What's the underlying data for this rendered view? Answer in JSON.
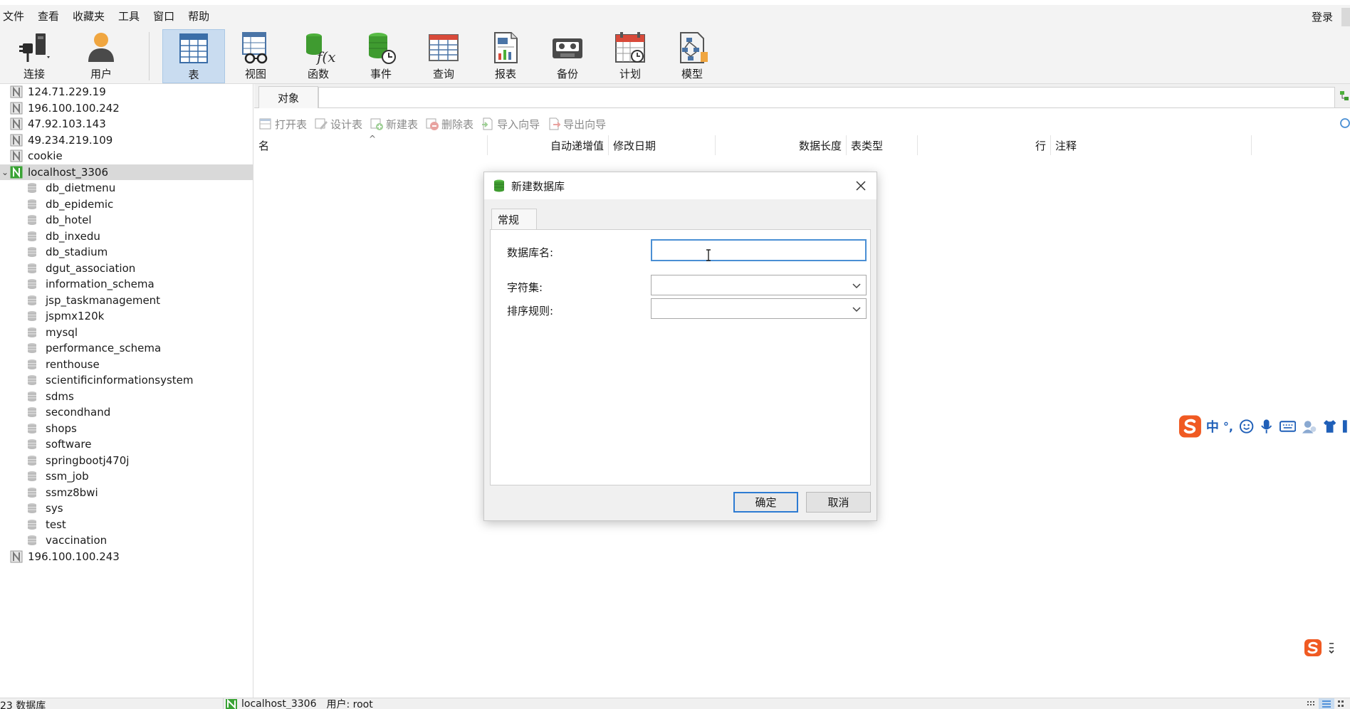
{
  "menu": {
    "items": [
      "文件",
      "查看",
      "收藏夹",
      "工具",
      "窗口",
      "帮助"
    ],
    "login": "登录"
  },
  "toolbar": {
    "buttons": [
      {
        "label": "连接",
        "icon": "plug-icon"
      },
      {
        "label": "用户",
        "icon": "user-icon"
      },
      {
        "label": "表",
        "icon": "table-icon",
        "active": true
      },
      {
        "label": "视图",
        "icon": "view-glasses-icon"
      },
      {
        "label": "函数",
        "icon": "function-icon"
      },
      {
        "label": "事件",
        "icon": "event-clock-icon"
      },
      {
        "label": "查询",
        "icon": "query-icon"
      },
      {
        "label": "报表",
        "icon": "report-icon"
      },
      {
        "label": "备份",
        "icon": "backup-tape-icon"
      },
      {
        "label": "计划",
        "icon": "calendar-icon"
      },
      {
        "label": "模型",
        "icon": "model-icon"
      }
    ]
  },
  "tree": {
    "connections_top": [
      "124.71.229.19",
      "196.100.100.242",
      "47.92.103.143",
      "49.234.219.109",
      "cookie"
    ],
    "selected_connection": "localhost_3306",
    "databases": [
      "db_dietmenu",
      "db_epidemic",
      "db_hotel",
      "db_inxedu",
      "db_stadium",
      "dgut_association",
      "information_schema",
      "jsp_taskmanagement",
      "jspmx120k",
      "mysql",
      "performance_schema",
      "renthouse",
      "scientificinformationsystem",
      "sdms",
      "secondhand",
      "shops",
      "software",
      "springbootj470j",
      "ssm_job",
      "ssmz8bwi",
      "sys",
      "test",
      "vaccination"
    ],
    "connections_bottom": [
      "196.100.100.243"
    ]
  },
  "objects": {
    "tab_label": "对象",
    "actions": [
      "打开表",
      "设计表",
      "新建表",
      "删除表",
      "导入向导",
      "导出向导"
    ],
    "columns": [
      "名",
      "自动递增值",
      "修改日期",
      "数据长度",
      "表类型",
      "行",
      "注释"
    ]
  },
  "dialog": {
    "title": "新建数据库",
    "tab": "常规",
    "fields": {
      "name_label": "数据库名:",
      "name_value": "",
      "charset_label": "字符集:",
      "charset_value": "",
      "collation_label": "排序规则:",
      "collation_value": ""
    },
    "ok": "确定",
    "cancel": "取消"
  },
  "ime": {
    "mode": "中",
    "punct": "°,"
  },
  "status": {
    "db_count": "23 数据库",
    "connection": "localhost_3306",
    "user": "用户: root"
  },
  "colors": {
    "accent": "#2d7bd2",
    "active_toolbar": "#c9dcf0",
    "sogou_orange": "#f05a22",
    "navicat_green": "#3aa335"
  }
}
